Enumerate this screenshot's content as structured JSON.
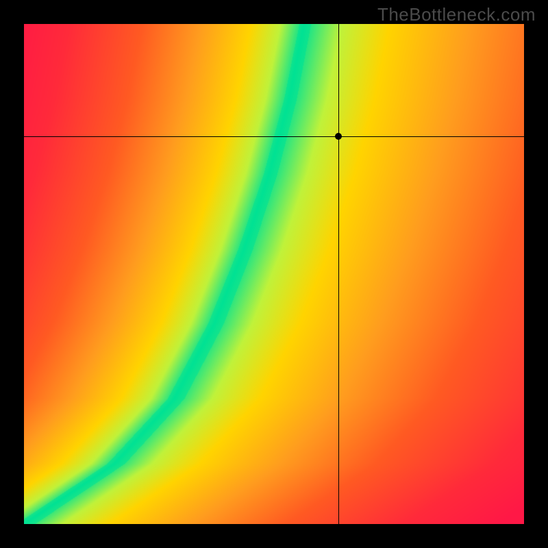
{
  "watermark": "TheBottleneck.com",
  "chart_data": {
    "type": "heatmap",
    "title": "",
    "xlabel": "",
    "ylabel": "",
    "xlim": [
      0,
      1
    ],
    "ylim": [
      0,
      1
    ],
    "grid": false,
    "marker": {
      "x": 0.63,
      "y": 0.775
    },
    "crosshair": {
      "x": 0.63,
      "y": 0.775
    },
    "optimal_curve": {
      "description": "Green optimal band from bottom-left to upper-center; steepens above y≈0.35",
      "points": [
        {
          "x": 0.0,
          "y": 0.0
        },
        {
          "x": 0.18,
          "y": 0.12
        },
        {
          "x": 0.3,
          "y": 0.25
        },
        {
          "x": 0.38,
          "y": 0.4
        },
        {
          "x": 0.44,
          "y": 0.55
        },
        {
          "x": 0.49,
          "y": 0.7
        },
        {
          "x": 0.53,
          "y": 0.85
        },
        {
          "x": 0.56,
          "y": 1.0
        }
      ]
    },
    "color_scale": {
      "description": "Distance from optimal curve mapped through green→yellow→orange→red",
      "stops": [
        {
          "d": 0.0,
          "color": "#00e294"
        },
        {
          "d": 0.08,
          "color": "#c0f23a"
        },
        {
          "d": 0.18,
          "color": "#ffd400"
        },
        {
          "d": 0.35,
          "color": "#ff9d1e"
        },
        {
          "d": 0.55,
          "color": "#ff5a22"
        },
        {
          "d": 0.8,
          "color": "#ff2a3a"
        },
        {
          "d": 1.0,
          "color": "#ff1846"
        }
      ]
    },
    "asymmetry": "Region right-and-below the curve skews yellow/orange; region left-and-above skews red faster"
  }
}
